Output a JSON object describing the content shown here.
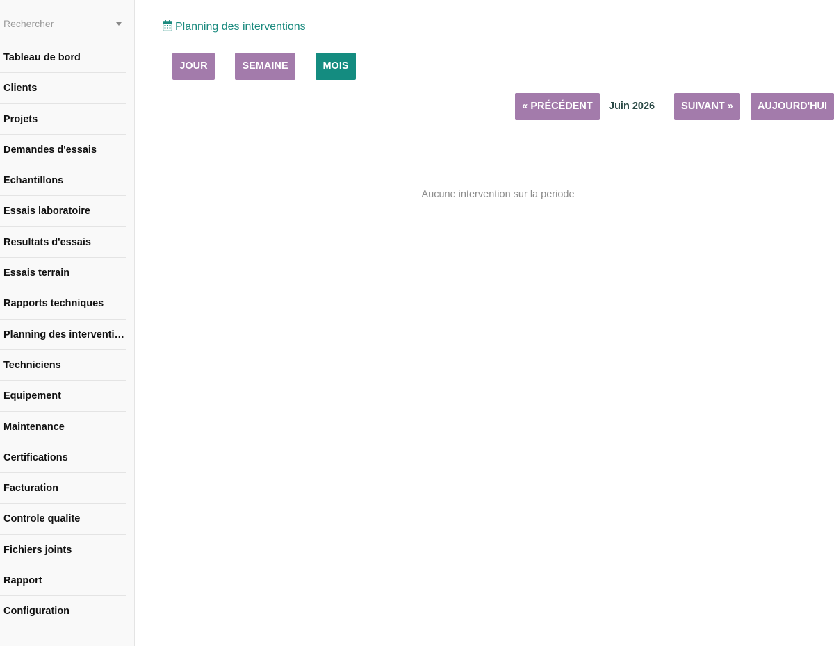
{
  "search": {
    "placeholder": "Rechercher",
    "icon": "chevron-down-icon"
  },
  "sidebar": {
    "items": [
      {
        "label": "Tableau de bord"
      },
      {
        "label": "Clients"
      },
      {
        "label": "Projets"
      },
      {
        "label": "Demandes d'essais"
      },
      {
        "label": "Echantillons"
      },
      {
        "label": "Essais laboratoire"
      },
      {
        "label": "Resultats d'essais"
      },
      {
        "label": "Essais terrain"
      },
      {
        "label": "Rapports techniques"
      },
      {
        "label": "Planning des interventions"
      },
      {
        "label": "Techniciens"
      },
      {
        "label": "Equipement"
      },
      {
        "label": "Maintenance"
      },
      {
        "label": "Certifications"
      },
      {
        "label": "Facturation"
      },
      {
        "label": "Controle qualite"
      },
      {
        "label": "Fichiers joints"
      },
      {
        "label": "Rapport"
      },
      {
        "label": "Configuration"
      }
    ]
  },
  "header": {
    "title": "Planning des interventions",
    "icon": "calendar-icon"
  },
  "views": {
    "day": "JOUR",
    "week": "SEMAINE",
    "month": "MOIS",
    "active": "MOIS"
  },
  "navigation": {
    "previous": "« PRÉCÉDENT",
    "period": "Juin 2026",
    "next": "SUIVANT »",
    "today": "AUJOURD'HUI"
  },
  "empty_message": "Aucune intervention sur la periode",
  "colors": {
    "accent": "#148c80",
    "button": "#a37bab",
    "title": "#1a8a7e"
  }
}
